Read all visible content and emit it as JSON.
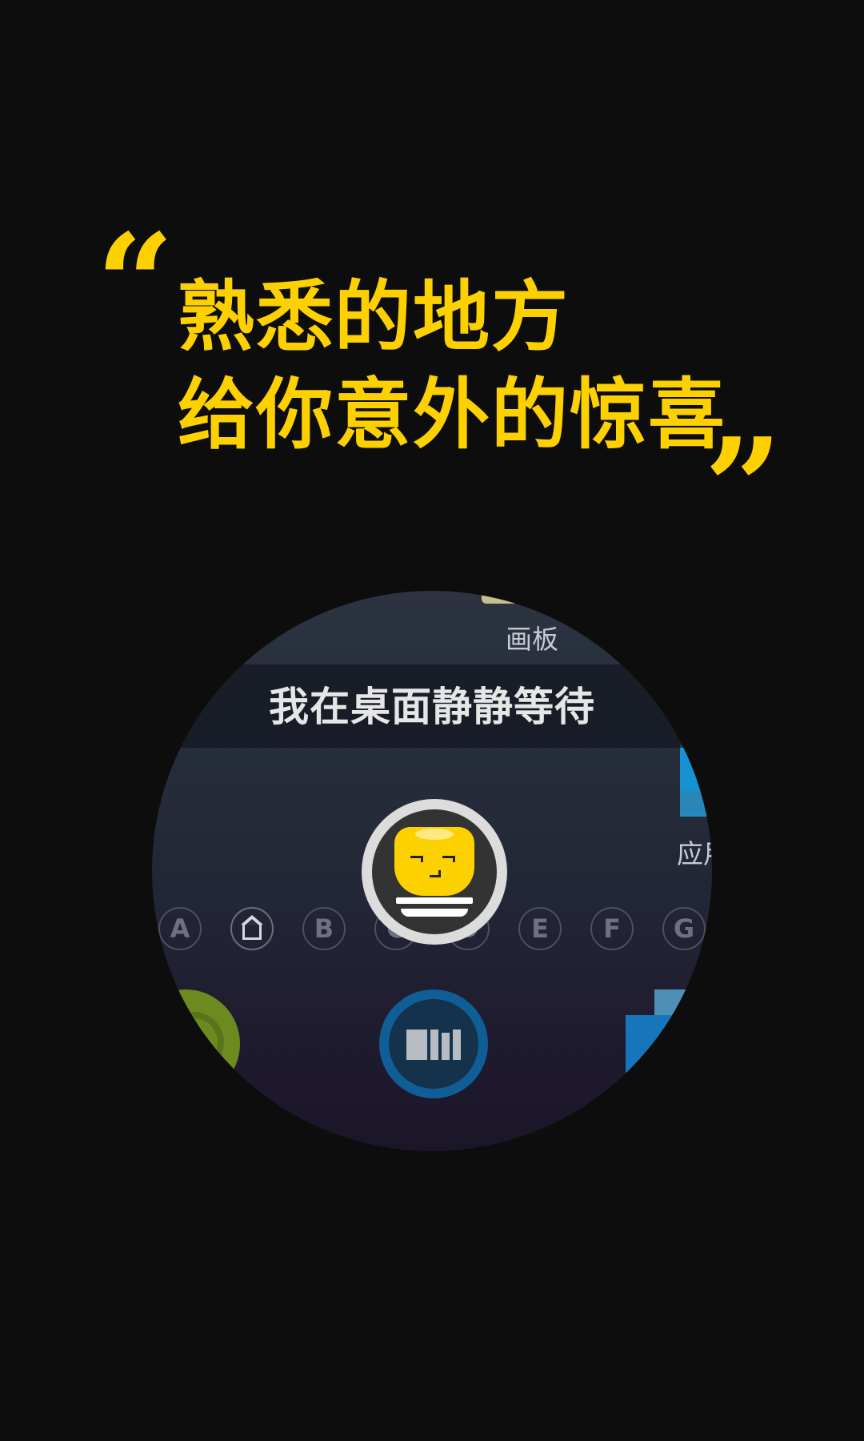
{
  "headline": {
    "open_quote": "“",
    "close_quote": "”",
    "line1": "熟悉的地方",
    "line2": "给你意外的惊喜"
  },
  "launcher": {
    "app_label_top": "画板",
    "banner_text": "我在桌面静静等待",
    "app_label_right": "应用",
    "alphabet": [
      "A",
      "home",
      "B",
      "C",
      "D",
      "E",
      "F",
      "G"
    ],
    "avatar_icon": "mascot-face-icon",
    "dock_icons": [
      "green-app-icon",
      "center-app-icon",
      "blue-app-icon"
    ]
  },
  "colors": {
    "accent": "#fdd100",
    "background": "#0d0d0d"
  }
}
